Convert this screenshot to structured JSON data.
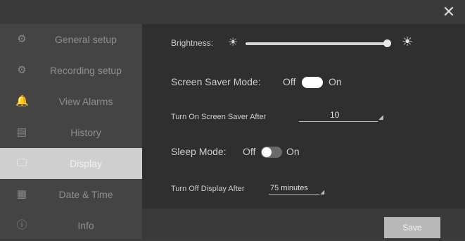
{
  "sidebar": {
    "items": [
      {
        "label": "General setup",
        "icon": "gear-icon",
        "glyph": "⚙"
      },
      {
        "label": "Recording setup",
        "icon": "recording-gear-icon",
        "glyph": "⚙"
      },
      {
        "label": "View Alarms",
        "icon": "bell-icon",
        "glyph": "🔔"
      },
      {
        "label": "History",
        "icon": "document-icon",
        "glyph": "▤"
      },
      {
        "label": "Display",
        "icon": "monitor-icon",
        "glyph": "🖵"
      },
      {
        "label": "Date & Time",
        "icon": "calendar-icon",
        "glyph": "▦"
      },
      {
        "label": "Info",
        "icon": "info-icon",
        "glyph": "ⓘ"
      }
    ]
  },
  "display": {
    "brightness_label": "Brightness:",
    "brightness_level": 1.0,
    "screen_saver_label": "Screen Saver Mode:",
    "screen_saver_off": "Off",
    "screen_saver_on": "On",
    "screen_saver_state": "on",
    "screen_saver_after_label": "Turn On Screen Saver After",
    "screen_saver_after_value": "10",
    "sleep_label": "Sleep Mode:",
    "sleep_off": "Off",
    "sleep_on": "On",
    "sleep_state": "off",
    "display_off_label": "Turn Off Display After",
    "display_off_value": "75 minutes"
  },
  "save_label": "Save",
  "colors": {
    "accent_active": "#cfcfcf",
    "toggle_on": "#ffffff",
    "toggle_off": "#6a6a6a"
  }
}
